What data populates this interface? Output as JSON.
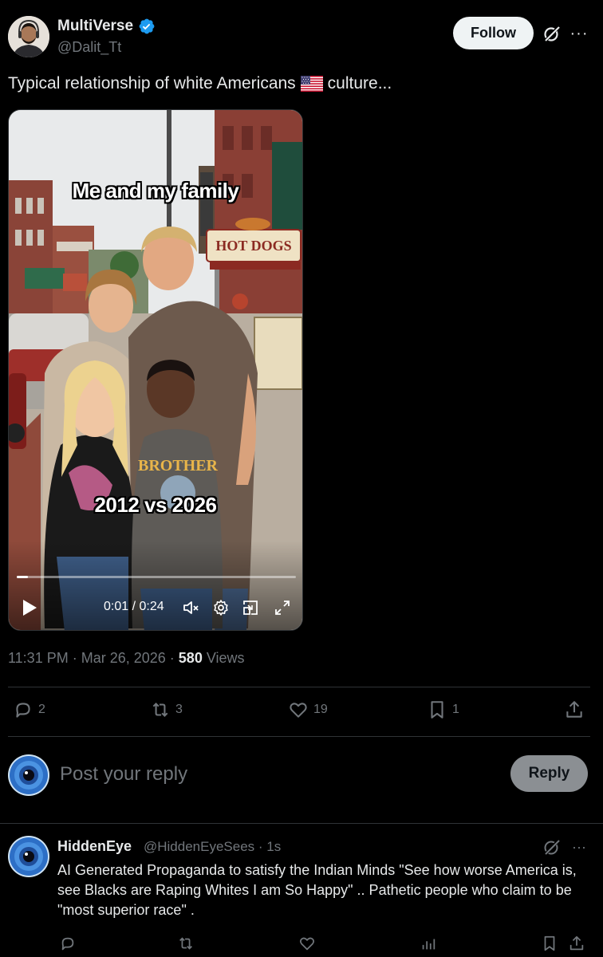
{
  "post": {
    "display_name": "MultiVerse",
    "handle": "@Dalit_Tt",
    "follow_label": "Follow",
    "text_before_flag": "Typical relationship of white Americans",
    "text_after_flag": "culture...",
    "media": {
      "caption_top": "Me and my family",
      "caption_middle": "2012 vs 2026",
      "time": "0:01 / 0:24",
      "progress": 0.04,
      "sign_hotdogs": "HOT DOGS",
      "shirt_text": "BROTHER"
    },
    "timestamp": "11:31 PM · Mar 26, 2026 ·",
    "views_count": "580",
    "views_label": "Views",
    "replies": "2",
    "reposts": "3",
    "likes": "19",
    "bookmarks": "1"
  },
  "reply_box": {
    "placeholder": "Post your reply",
    "button_label": "Reply"
  },
  "comment": {
    "name": "HiddenEye",
    "handle_time": "@HiddenEyeSees · 1s",
    "text": "AI Generated Propaganda to satisfy the Indian Minds \"See how worse America is, see Blacks are Raping Whites I am So Happy\" .. Pathetic people who claim to be \"most superior race\" ."
  },
  "colors": {
    "background": "#000000",
    "text_primary": "#e7e9ea",
    "text_secondary": "#71767b",
    "verified": "#1d9bf0",
    "divider": "#2f3336"
  }
}
